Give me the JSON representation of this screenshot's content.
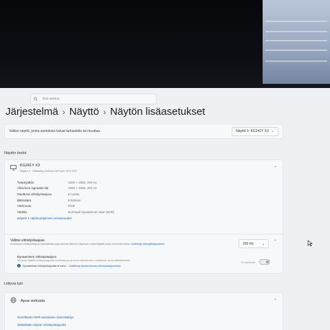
{
  "search": {
    "placeholder": "Etsi asetus"
  },
  "breadcrumb": [
    "Järjestelmä",
    "Näyttö",
    "Näytön lisäasetukset"
  ],
  "select_display": {
    "label": "Valitse näyttö, jonka asetuksia haluat tarkastella tai muuttaa.",
    "value": "Näyttö 1: KG241Y X3"
  },
  "display_info": {
    "section_title": "Näytön tiedot",
    "monitor_name": "KG241Y X3",
    "monitor_sub": "Näyttö 1: Yhdistetty NVIDIA GeForce GTX 970",
    "rows": [
      {
        "key": "Työpöytätila",
        "value": "1920 × 1080, 200 Hz"
      },
      {
        "key": "Aktiivinen signaalin tila",
        "value": "1920 × 1080, 200 Hz"
      },
      {
        "key": "Muuttuva virkistystaajuus",
        "value": "Ei tuettu"
      },
      {
        "key": "Bittimäärä",
        "value": "8-bittinen"
      },
      {
        "key": "Värimuoto",
        "value": "RGB"
      },
      {
        "key": "Väritila",
        "value": "Normaali dynaaminen alue (SDR)"
      }
    ],
    "adapter_link": "Näytön 1 näytönohjaimen ominaisuudet"
  },
  "refresh_rate": {
    "title": "Valitse virkistystaajuus",
    "description": "Korkeampi virkistystaajuus mahdollistaa sujuvamman liikkeen näytössä, mutta käyttää myös enemmän virtaa.",
    "desc_link": "Lisätietoja virkistystaajuudesta",
    "value": "200 Hz",
    "dynamic_title": "Dynaaminen virkistystaajuus",
    "dynamic_desc": "Windows säätää virkistystaajuutta suorituskyvyn ja virran säästämisen mukaisesti, virran säästämiseksi.",
    "dynamic_info": "Dynaamista virkistystaajuutta ei tueta.",
    "dynamic_info_link": "Lisätietoja dynaamisesta virkistystaajuudesta",
    "toggle_label": "Ei käytössä"
  },
  "related": {
    "section_title": "Liittyvä tuki",
    "help_title": "Apua verkosta",
    "links": [
      "Suorittavan HDR-asetuksen vianmääritys",
      "Säädetään näytön virkistystaajuutta"
    ]
  },
  "colors": {
    "accent": "#1d5fa8",
    "window_bg": "#eef0f3",
    "card_bg": "#f7f8f9"
  }
}
